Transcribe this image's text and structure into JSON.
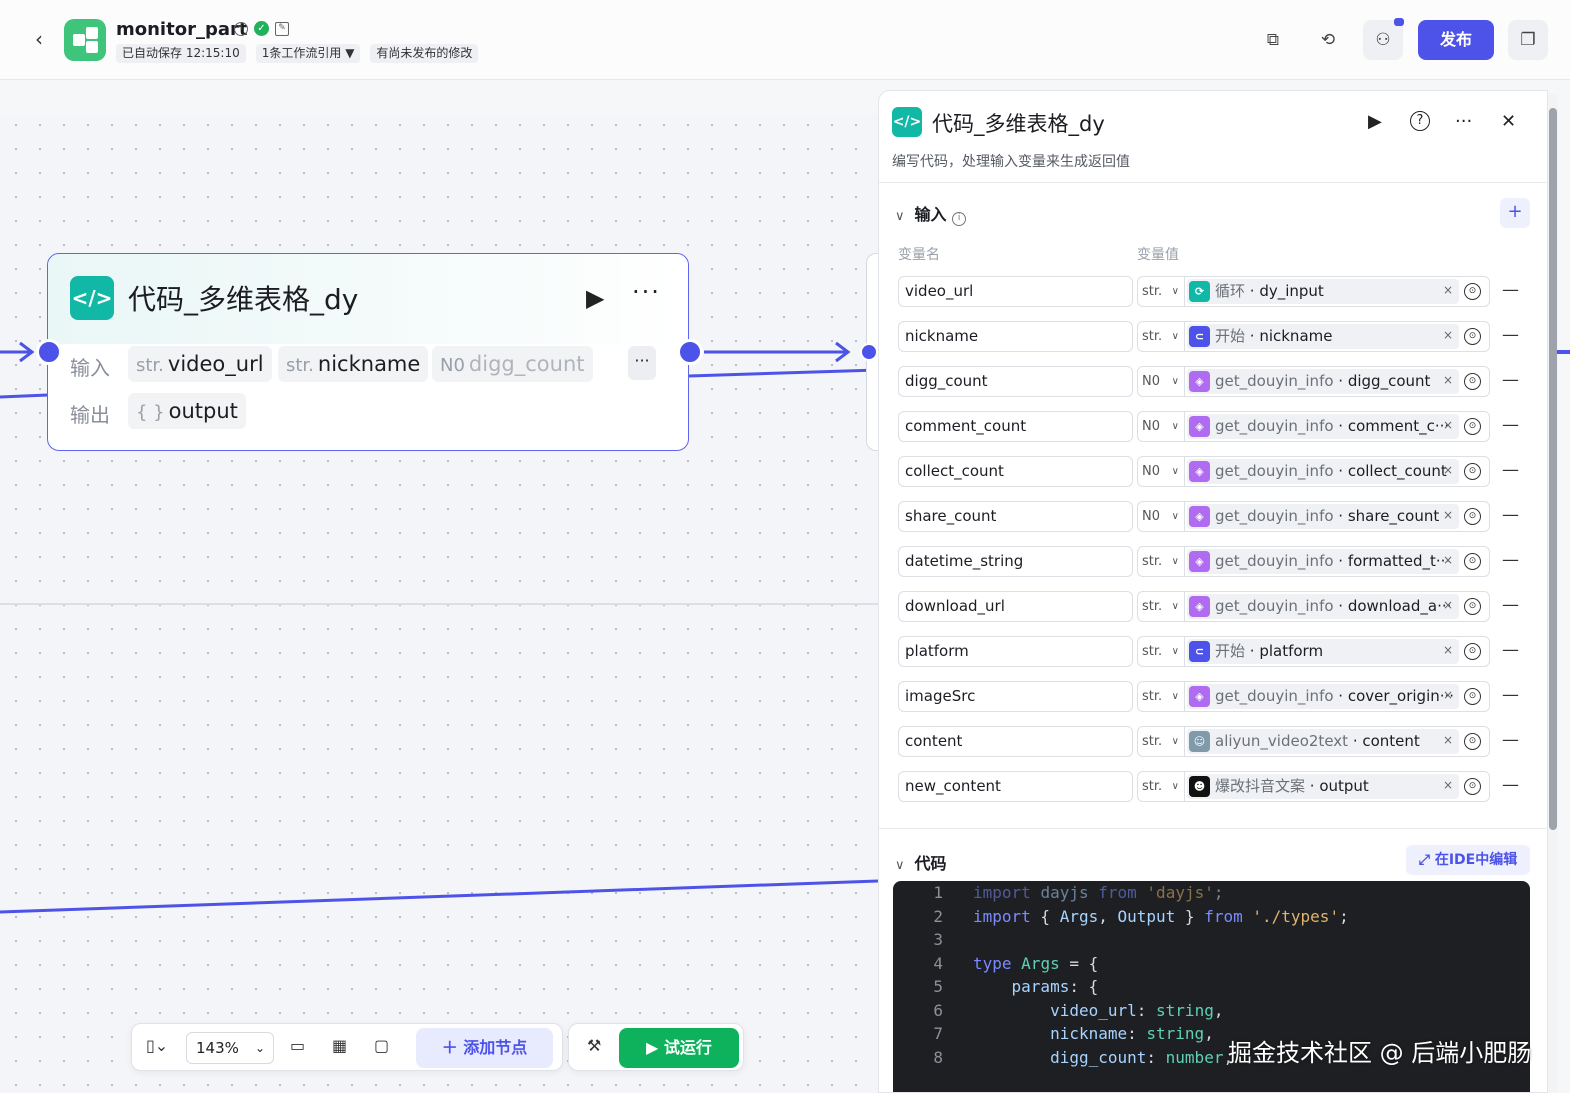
{
  "header": {
    "back_icon": "chevron-left-icon",
    "app_name": "monitor_part",
    "autosave": "已自动保存 12:15:10",
    "workflow_refs": "1条工作流引用",
    "unpublished": "有尚未发布的修改",
    "publish_label": "发布"
  },
  "node": {
    "title": "代码_多维表格_dy",
    "input_label": "输入",
    "output_label": "输出",
    "inputs": [
      {
        "type": "str.",
        "name": "video_url"
      },
      {
        "type": "str.",
        "name": "nickname"
      },
      {
        "type": "N0",
        "name": "digg_count"
      }
    ],
    "output_type": "{ }",
    "output_name": "output",
    "more": "···"
  },
  "toolbar": {
    "zoom": "143%",
    "add_node": "添加节点",
    "test_run": "试运行"
  },
  "panel": {
    "title": "代码_多维表格_dy",
    "description": "编写代码，处理输入变量来生成返回值",
    "input_section": "输入",
    "col_name": "变量名",
    "col_value": "变量值",
    "code_section": "代码",
    "ide_button": "在IDE中编辑",
    "rows": [
      {
        "name": "video_url",
        "type": "str.",
        "source": "循环",
        "field": "dy_input",
        "icon": "loop-icon",
        "color": "#12b8a6"
      },
      {
        "name": "nickname",
        "type": "str.",
        "source": "开始",
        "field": "nickname",
        "icon": "start-icon",
        "color": "#4d53e8"
      },
      {
        "name": "digg_count",
        "type": "N0",
        "source": "get_douyin_info",
        "field": "digg_count",
        "icon": "plugin-icon",
        "color": "#b06cf0"
      },
      {
        "name": "comment_count",
        "type": "N0",
        "source": "get_douyin_info",
        "field": "comment_c···",
        "icon": "plugin-icon",
        "color": "#b06cf0"
      },
      {
        "name": "collect_count",
        "type": "N0",
        "source": "get_douyin_info",
        "field": "collect_count",
        "icon": "plugin-icon",
        "color": "#b06cf0"
      },
      {
        "name": "share_count",
        "type": "N0",
        "source": "get_douyin_info",
        "field": "share_count",
        "icon": "plugin-icon",
        "color": "#b06cf0"
      },
      {
        "name": "datetime_string",
        "type": "str.",
        "source": "get_douyin_info",
        "field": "formatted_t···",
        "icon": "plugin-icon",
        "color": "#b06cf0"
      },
      {
        "name": "download_url",
        "type": "str.",
        "source": "get_douyin_info",
        "field": "download_a···",
        "icon": "plugin-icon",
        "color": "#b06cf0"
      },
      {
        "name": "platform",
        "type": "str.",
        "source": "开始",
        "field": "platform",
        "icon": "start-icon",
        "color": "#4d53e8"
      },
      {
        "name": "imageSrc",
        "type": "str.",
        "source": "get_douyin_info",
        "field": "cover_origin···",
        "icon": "plugin-icon",
        "color": "#b06cf0"
      },
      {
        "name": "content",
        "type": "str.",
        "source": "aliyun_video2text",
        "field": "content",
        "icon": "avatar-icon",
        "color": "#7f9aa8"
      },
      {
        "name": "new_content",
        "type": "str.",
        "source": "爆改抖音文案",
        "field": "output",
        "icon": "robot-icon",
        "color": "#111111"
      }
    ],
    "code_lines": [
      {
        "n": "1",
        "text": "import dayjs from 'dayjs';"
      },
      {
        "n": "2",
        "text": "import { Args, Output } from './types';"
      },
      {
        "n": "3",
        "text": ""
      },
      {
        "n": "4",
        "text": "type Args = {"
      },
      {
        "n": "5",
        "text": "    params: {"
      },
      {
        "n": "6",
        "text": "        video_url: string,"
      },
      {
        "n": "7",
        "text": "        nickname: string,"
      },
      {
        "n": "8",
        "text": "        digg_count: number,"
      }
    ]
  },
  "watermark": "掘金技术社区 @ 后端小肥肠",
  "colors": {
    "accent": "#4d53e8",
    "code_node": "#12b8a6",
    "run": "#0eb25d"
  }
}
